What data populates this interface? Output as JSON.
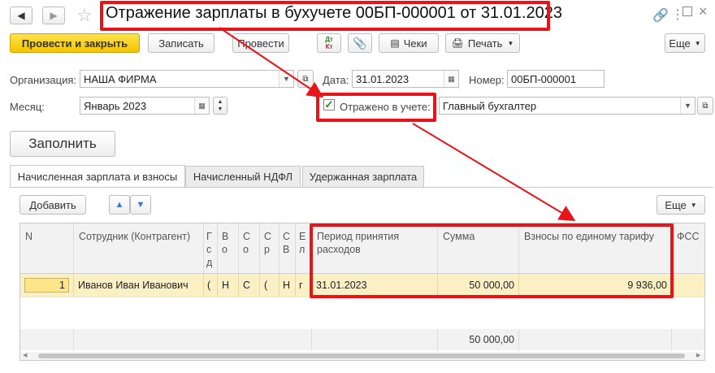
{
  "window": {
    "title": "Отражение зарплаты в бухучете 00БП-000001 от 31.01.2023"
  },
  "toolbar": {
    "post_close": "Провести и закрыть",
    "save": "Записать",
    "post": "Провести",
    "dtkt_top": "Дт",
    "dtkt_bottom": "Кт",
    "checks": "Чеки",
    "print": "Печать",
    "more": "Еще"
  },
  "form": {
    "org_label": "Организация:",
    "org_value": "НАША ФИРМА",
    "date_label": "Дата:",
    "date_value": "31.01.2023",
    "number_label": "Номер:",
    "number_value": "00БП-000001",
    "month_label": "Месяц:",
    "month_value": "Январь 2023",
    "reflected_label": "Отражено в учете:",
    "reflected_checked": true,
    "responsible_value": "Главный бухгалтер",
    "fill_button": "Заполнить"
  },
  "tabs": [
    {
      "label": "Начисленная зарплата и взносы",
      "active": true
    },
    {
      "label": "Начисленный НДФЛ",
      "active": false
    },
    {
      "label": "Удержанная зарплата",
      "active": false
    }
  ],
  "grid_toolbar": {
    "add": "Добавить",
    "more": "Еще"
  },
  "table": {
    "headers": {
      "n": "N",
      "employee": "Сотрудник (Контрагент)",
      "c1": "Г\nс\nд",
      "c2": "В\nо",
      "c3": "С\nо",
      "c4": "С\nр",
      "c5": "С\nВ",
      "c6": "Е\nл",
      "period": "Период принятия расходов",
      "sum": "Сумма",
      "contrib": "Взносы по единому тарифу",
      "fss": "ФСС"
    },
    "rows": [
      {
        "n": "1",
        "employee": "Иванов Иван Иванович",
        "c1": "(",
        "c2": "Н",
        "c3": "С",
        "c4": "(",
        "c5": "Н",
        "c6": "г",
        "period": "31.01.2023",
        "sum": "50 000,00",
        "contrib": "9 936,00"
      }
    ],
    "footer": {
      "sum": "50 000,00"
    }
  },
  "colors": {
    "highlight": "#e8141a",
    "primary_button": "#f5c400",
    "selected_row": "#fbf0c4"
  }
}
